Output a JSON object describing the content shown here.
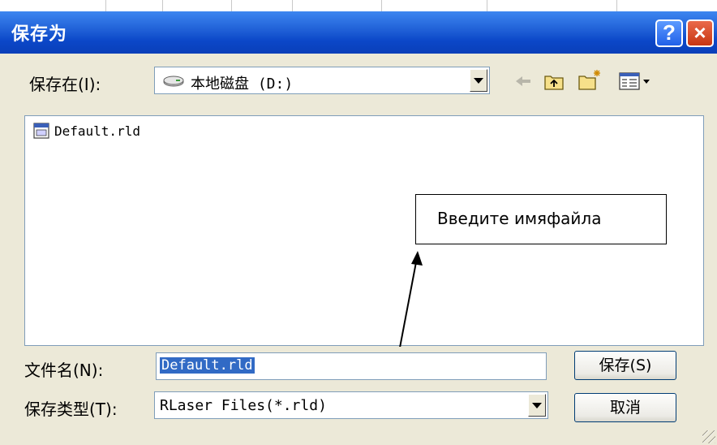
{
  "dialog": {
    "title": "保存为",
    "help_glyph": "?",
    "close_glyph": "×"
  },
  "toolbar": {
    "save_in_label": "保存在(I):",
    "location_value": "本地磁盘 (D:)",
    "icons": [
      "drive-icon",
      "back-arrow-icon",
      "up-folder-icon",
      "new-folder-icon",
      "view-menu-icon"
    ]
  },
  "files": [
    {
      "name": "Default.rld",
      "icon": "rld-file-icon"
    }
  ],
  "annotation": {
    "text": "Введите имяфайла"
  },
  "form": {
    "filename_label": "文件名(N):",
    "filename_value": "Default.rld",
    "filetype_label": "保存类型(T):",
    "filetype_value": "RLaser Files(*.rld)"
  },
  "buttons": {
    "save": "保存(S)",
    "cancel": "取消"
  },
  "colors": {
    "titlebar": "#0b47c8",
    "dialog_bg": "#ece9d8",
    "selection": "#316ac5"
  }
}
